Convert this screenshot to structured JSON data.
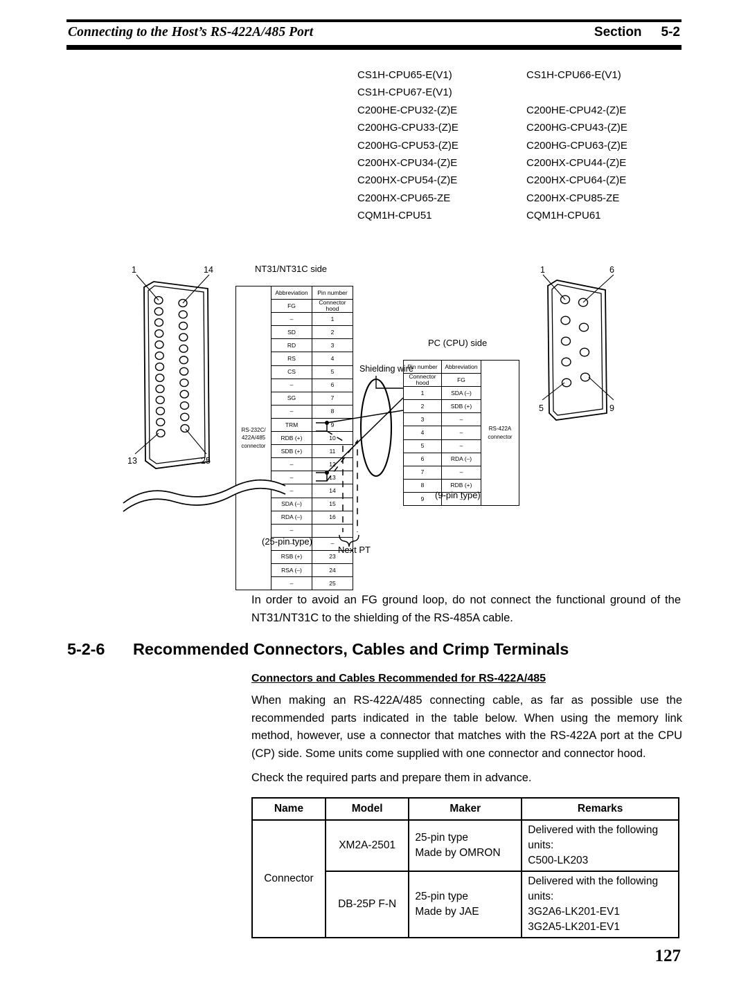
{
  "header": {
    "title": "Connecting to the Host’s RS-422A/485 Port",
    "section_label": "Section",
    "section_number": "5-2"
  },
  "cpu_models": [
    {
      "left": "CS1H-CPU65-E(V1)",
      "right": "CS1H-CPU66-E(V1)"
    },
    {
      "left": "CS1H-CPU67-E(V1)",
      "right": ""
    },
    {
      "left": "C200HE-CPU32-(Z)E",
      "right": "C200HE-CPU42-(Z)E"
    },
    {
      "left": "C200HG-CPU33-(Z)E",
      "right": "C200HG-CPU43-(Z)E"
    },
    {
      "left": "C200HG-CPU53-(Z)E",
      "right": "C200HG-CPU63-(Z)E"
    },
    {
      "left": "C200HX-CPU34-(Z)E",
      "right": "C200HX-CPU44-(Z)E"
    },
    {
      "left": "C200HX-CPU54-(Z)E",
      "right": "C200HX-CPU64-(Z)E"
    },
    {
      "left": "C200HX-CPU65-ZE",
      "right": "C200HX-CPU85-ZE"
    },
    {
      "left": "CQM1H-CPU51",
      "right": "CQM1H-CPU61"
    }
  ],
  "diagram": {
    "left_connector": {
      "caption": "",
      "pin_labels": {
        "top_left": "1",
        "top_right": "14",
        "bottom_left": "13",
        "bottom_right": "25"
      }
    },
    "right_connector": {
      "pin_labels": {
        "top_left": "1",
        "top_right": "6",
        "bottom_left": "5",
        "bottom_right": "9"
      }
    },
    "nt31_table": {
      "title": "NT31/NT31C side",
      "side_label": "RS-232C/\n422A/485\nconnector",
      "side_label_lines": [
        "RS-232C/",
        "422A/485",
        "connector"
      ],
      "headers": {
        "abbreviation": "Abbreviation",
        "pin_number": "Pin number"
      },
      "rows": [
        {
          "abbr": "FG",
          "pin": "Connector hood"
        },
        {
          "abbr": "–",
          "pin": "1"
        },
        {
          "abbr": "SD",
          "pin": "2"
        },
        {
          "abbr": "RD",
          "pin": "3"
        },
        {
          "abbr": "RS",
          "pin": "4"
        },
        {
          "abbr": "CS",
          "pin": "5"
        },
        {
          "abbr": "–",
          "pin": "6"
        },
        {
          "abbr": "SG",
          "pin": "7"
        },
        {
          "abbr": "–",
          "pin": "8"
        },
        {
          "abbr": "TRM",
          "pin": "9"
        },
        {
          "abbr": "RDB (+)",
          "pin": "10"
        },
        {
          "abbr": "SDB (+)",
          "pin": "11"
        },
        {
          "abbr": "–",
          "pin": "12"
        },
        {
          "abbr": "–",
          "pin": "13"
        },
        {
          "abbr": "–",
          "pin": "14"
        },
        {
          "abbr": "SDA (–)",
          "pin": "15"
        },
        {
          "abbr": "RDA (–)",
          "pin": "16"
        },
        {
          "abbr": "–",
          "pin": ""
        },
        {
          "abbr": "–",
          "pin": "–"
        },
        {
          "abbr": "RSB (+)",
          "pin": "23"
        },
        {
          "abbr": "RSA (–)",
          "pin": "24"
        },
        {
          "abbr": "–",
          "pin": "25"
        }
      ],
      "footer": "(25-pin type)"
    },
    "pc_table": {
      "title": "PC (CPU) side",
      "side_label_lines": [
        "RS-422A",
        "connector"
      ],
      "headers": {
        "pin_number": "Pin number",
        "abbreviation": "Abbreviation"
      },
      "rows": [
        {
          "pin": "Connector hood",
          "abbr": "FG"
        },
        {
          "pin": "1",
          "abbr": "SDA (–)"
        },
        {
          "pin": "2",
          "abbr": "SDB (+)"
        },
        {
          "pin": "3",
          "abbr": "–"
        },
        {
          "pin": "4",
          "abbr": "–"
        },
        {
          "pin": "5",
          "abbr": "–"
        },
        {
          "pin": "6",
          "abbr": "RDA (–)"
        },
        {
          "pin": "7",
          "abbr": "–"
        },
        {
          "pin": "8",
          "abbr": "RDB (+)"
        },
        {
          "pin": "9",
          "abbr": "–"
        }
      ],
      "footer": "(9-pin type)"
    },
    "annotations": {
      "shielding_wire": "Shielding wire",
      "next_pt": "Next PT"
    }
  },
  "note_paragraph": "In order to avoid an FG ground loop, do not connect the functional ground of the NT31/NT31C to the shielding of the RS-485A cable.",
  "section_heading": {
    "number": "5-2-6",
    "text": "Recommended Connectors, Cables and Crimp Terminals"
  },
  "subheading": "Connectors and Cables Recommended for RS-422A/485",
  "body_paragraph_1": "When making an RS-422A/485 connecting cable, as far as possible use the recommended parts indicated in the table below. When using the memory link method, however, use a connector that matches with the RS-422A port at the CPU (CP) side. Some units come supplied with one connector and connector hood.",
  "body_paragraph_2": "Check the required parts and prepare them in advance.",
  "parts_table": {
    "headers": [
      "Name",
      "Model",
      "Maker",
      "Remarks"
    ],
    "rows": [
      {
        "name": "Connector",
        "model": "XM2A-2501",
        "maker_lines": [
          "25-pin type",
          "Made by OMRON"
        ],
        "remarks_lines": [
          "Delivered with the following units:",
          "C500-LK203"
        ]
      },
      {
        "name": "",
        "model": "DB-25P F-N",
        "maker_lines": [
          "25-pin type",
          "Made by JAE"
        ],
        "remarks_lines": [
          "Delivered with the following units:",
          "3G2A6-LK201-EV1",
          "3G2A5-LK201-EV1"
        ]
      }
    ]
  },
  "page_number": "127"
}
